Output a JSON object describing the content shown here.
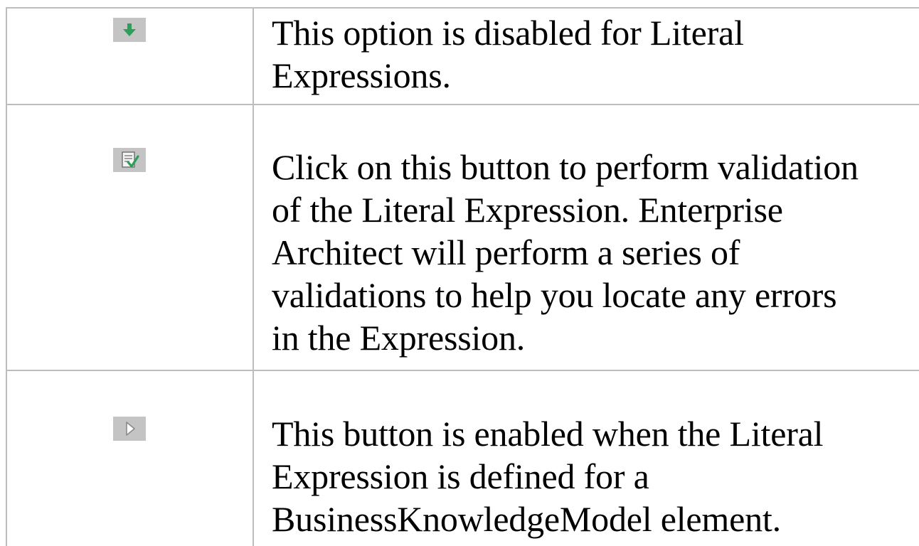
{
  "rows": [
    {
      "icon": "move-down-arrow-icon",
      "icon_color": "#2e9e5b",
      "description": "This option is disabled for Literal\nExpressions."
    },
    {
      "icon": "validate-checkmark-icon",
      "icon_color": "#2e9e5b",
      "description": "Click on this button to perform validation\nof the Literal Expression.  Enterprise\nArchitect will perform a series of\nvalidations to help you locate any errors\nin the Expression."
    },
    {
      "icon": "play-triangle-icon",
      "icon_color": "#8a8a8a",
      "description": "This button is enabled when the Literal\nExpression is defined for a\nBusinessKnowledgeModel element."
    }
  ]
}
